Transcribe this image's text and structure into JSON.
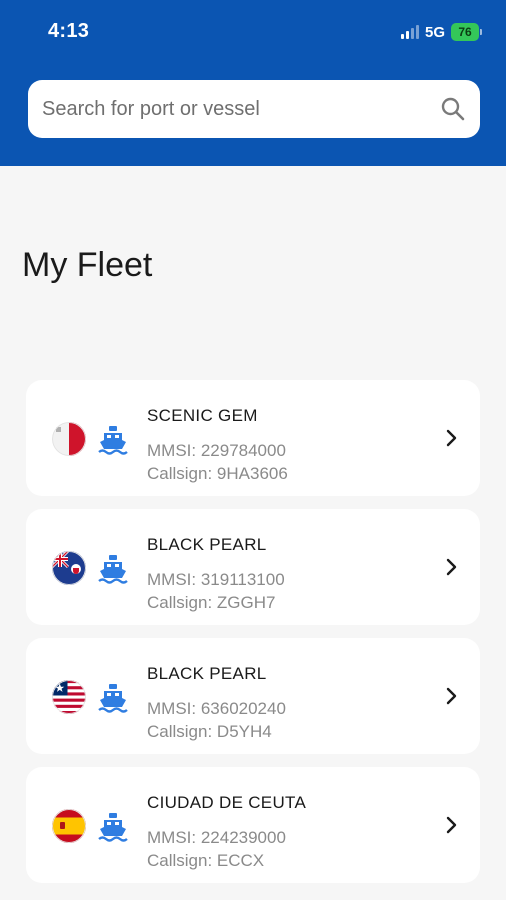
{
  "status_bar": {
    "time": "4:13",
    "network": "5G",
    "battery": "76"
  },
  "search": {
    "placeholder": "Search for port or vessel",
    "value": ""
  },
  "page": {
    "title": "My Fleet"
  },
  "fleet": [
    {
      "name": "SCENIC GEM",
      "mmsi": "MMSI: 229784000",
      "callsign": "Callsign: 9HA3606",
      "flag": "malta-flag-icon"
    },
    {
      "name": "BLACK PEARL",
      "mmsi": "MMSI: 319113100",
      "callsign": "Callsign: ZGGH7",
      "flag": "cayman-islands-flag-icon"
    },
    {
      "name": "BLACK PEARL",
      "mmsi": "MMSI: 636020240",
      "callsign": "Callsign: D5YH4",
      "flag": "liberia-flag-icon"
    },
    {
      "name": "CIUDAD DE CEUTA",
      "mmsi": "MMSI: 224239000",
      "callsign": "Callsign: ECCX",
      "flag": "spain-flag-icon"
    }
  ],
  "colors": {
    "header": "#0b55b2",
    "ship_icon": "#2f7de1",
    "background": "#f6f6f6"
  }
}
